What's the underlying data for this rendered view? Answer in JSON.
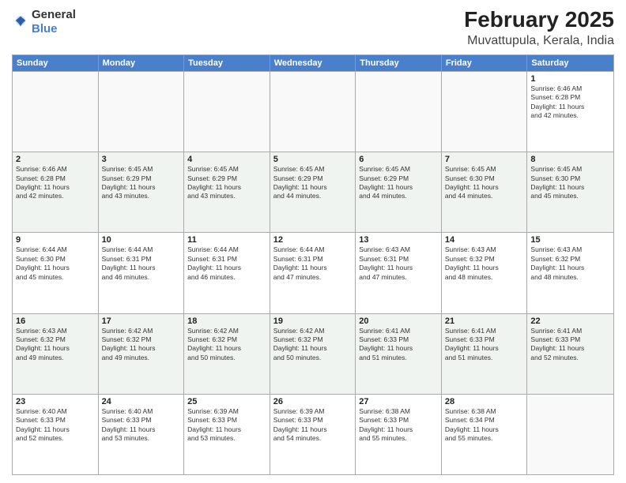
{
  "logo": {
    "general": "General",
    "blue": "Blue"
  },
  "title": "February 2025",
  "location": "Muvattupula, Kerala, India",
  "days_of_week": [
    "Sunday",
    "Monday",
    "Tuesday",
    "Wednesday",
    "Thursday",
    "Friday",
    "Saturday"
  ],
  "weeks": [
    {
      "alt": false,
      "days": [
        {
          "day": "",
          "empty": true
        },
        {
          "day": "",
          "empty": true
        },
        {
          "day": "",
          "empty": true
        },
        {
          "day": "",
          "empty": true
        },
        {
          "day": "",
          "empty": true
        },
        {
          "day": "",
          "empty": true
        },
        {
          "day": "1",
          "info": "Sunrise: 6:46 AM\nSunset: 6:28 PM\nDaylight: 11 hours\nand 42 minutes."
        }
      ]
    },
    {
      "alt": true,
      "days": [
        {
          "day": "2",
          "info": "Sunrise: 6:46 AM\nSunset: 6:28 PM\nDaylight: 11 hours\nand 42 minutes."
        },
        {
          "day": "3",
          "info": "Sunrise: 6:45 AM\nSunset: 6:29 PM\nDaylight: 11 hours\nand 43 minutes."
        },
        {
          "day": "4",
          "info": "Sunrise: 6:45 AM\nSunset: 6:29 PM\nDaylight: 11 hours\nand 43 minutes."
        },
        {
          "day": "5",
          "info": "Sunrise: 6:45 AM\nSunset: 6:29 PM\nDaylight: 11 hours\nand 44 minutes."
        },
        {
          "day": "6",
          "info": "Sunrise: 6:45 AM\nSunset: 6:29 PM\nDaylight: 11 hours\nand 44 minutes."
        },
        {
          "day": "7",
          "info": "Sunrise: 6:45 AM\nSunset: 6:30 PM\nDaylight: 11 hours\nand 44 minutes."
        },
        {
          "day": "8",
          "info": "Sunrise: 6:45 AM\nSunset: 6:30 PM\nDaylight: 11 hours\nand 45 minutes."
        }
      ]
    },
    {
      "alt": false,
      "days": [
        {
          "day": "9",
          "info": "Sunrise: 6:44 AM\nSunset: 6:30 PM\nDaylight: 11 hours\nand 45 minutes."
        },
        {
          "day": "10",
          "info": "Sunrise: 6:44 AM\nSunset: 6:31 PM\nDaylight: 11 hours\nand 46 minutes."
        },
        {
          "day": "11",
          "info": "Sunrise: 6:44 AM\nSunset: 6:31 PM\nDaylight: 11 hours\nand 46 minutes."
        },
        {
          "day": "12",
          "info": "Sunrise: 6:44 AM\nSunset: 6:31 PM\nDaylight: 11 hours\nand 47 minutes."
        },
        {
          "day": "13",
          "info": "Sunrise: 6:43 AM\nSunset: 6:31 PM\nDaylight: 11 hours\nand 47 minutes."
        },
        {
          "day": "14",
          "info": "Sunrise: 6:43 AM\nSunset: 6:32 PM\nDaylight: 11 hours\nand 48 minutes."
        },
        {
          "day": "15",
          "info": "Sunrise: 6:43 AM\nSunset: 6:32 PM\nDaylight: 11 hours\nand 48 minutes."
        }
      ]
    },
    {
      "alt": true,
      "days": [
        {
          "day": "16",
          "info": "Sunrise: 6:43 AM\nSunset: 6:32 PM\nDaylight: 11 hours\nand 49 minutes."
        },
        {
          "day": "17",
          "info": "Sunrise: 6:42 AM\nSunset: 6:32 PM\nDaylight: 11 hours\nand 49 minutes."
        },
        {
          "day": "18",
          "info": "Sunrise: 6:42 AM\nSunset: 6:32 PM\nDaylight: 11 hours\nand 50 minutes."
        },
        {
          "day": "19",
          "info": "Sunrise: 6:42 AM\nSunset: 6:32 PM\nDaylight: 11 hours\nand 50 minutes."
        },
        {
          "day": "20",
          "info": "Sunrise: 6:41 AM\nSunset: 6:33 PM\nDaylight: 11 hours\nand 51 minutes."
        },
        {
          "day": "21",
          "info": "Sunrise: 6:41 AM\nSunset: 6:33 PM\nDaylight: 11 hours\nand 51 minutes."
        },
        {
          "day": "22",
          "info": "Sunrise: 6:41 AM\nSunset: 6:33 PM\nDaylight: 11 hours\nand 52 minutes."
        }
      ]
    },
    {
      "alt": false,
      "days": [
        {
          "day": "23",
          "info": "Sunrise: 6:40 AM\nSunset: 6:33 PM\nDaylight: 11 hours\nand 52 minutes."
        },
        {
          "day": "24",
          "info": "Sunrise: 6:40 AM\nSunset: 6:33 PM\nDaylight: 11 hours\nand 53 minutes."
        },
        {
          "day": "25",
          "info": "Sunrise: 6:39 AM\nSunset: 6:33 PM\nDaylight: 11 hours\nand 53 minutes."
        },
        {
          "day": "26",
          "info": "Sunrise: 6:39 AM\nSunset: 6:33 PM\nDaylight: 11 hours\nand 54 minutes."
        },
        {
          "day": "27",
          "info": "Sunrise: 6:38 AM\nSunset: 6:33 PM\nDaylight: 11 hours\nand 55 minutes."
        },
        {
          "day": "28",
          "info": "Sunrise: 6:38 AM\nSunset: 6:34 PM\nDaylight: 11 hours\nand 55 minutes."
        },
        {
          "day": "",
          "empty": true
        }
      ]
    }
  ]
}
